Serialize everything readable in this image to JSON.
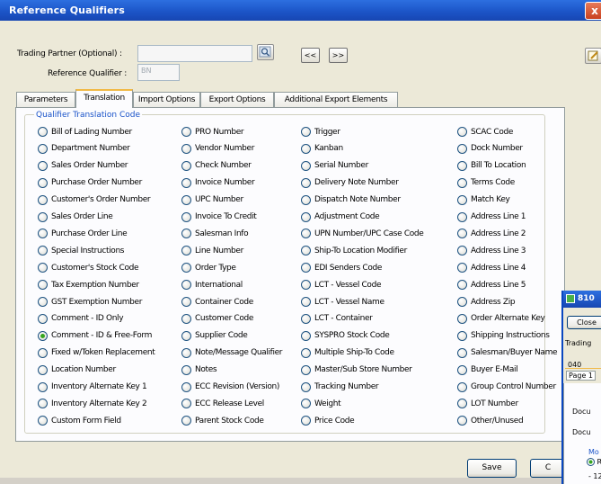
{
  "title": "Reference Qualifiers",
  "close_glyph": "x",
  "trading_partner_label": "Trading Partner (Optional) :",
  "trading_partner_value": "",
  "reference_qualifier_label": "Reference Qualifier :",
  "reference_qualifier_value": "BN",
  "nav_prev": "<<",
  "nav_next": ">>",
  "tabs": [
    "Parameters",
    "Translation",
    "Import Options",
    "Export Options",
    "Additional Export Elements"
  ],
  "active_tab": "Translation",
  "group_title": "Qualifier Translation Code",
  "columns": [
    [
      "Bill of Lading Number",
      "Department Number",
      "Sales Order Number",
      "Purchase Order Number",
      "Customer's Order Number",
      "Sales Order Line",
      "Purchase Order Line",
      "Special Instructions",
      "Customer's Stock Code",
      "Tax Exemption Number",
      "GST Exemption Number",
      "Comment - ID Only",
      "Comment - ID & Free-Form",
      "Fixed w/Token Replacement",
      "Location Number",
      "Inventory Alternate Key 1",
      "Inventory Alternate Key 2",
      "Custom Form Field"
    ],
    [
      "PRO Number",
      "Vendor Number",
      "Check Number",
      "Invoice Number",
      "UPC Number",
      "Invoice To Credit",
      "Salesman Info",
      "Line Number",
      "Order Type",
      "International",
      "Container Code",
      "Customer Code",
      "Supplier Code",
      "Note/Message Qualifier",
      "Notes",
      "ECC Revision (Version)",
      "ECC Release Level",
      "Parent Stock Code"
    ],
    [
      "Trigger",
      "Kanban",
      "Serial Number",
      "Delivery Note Number",
      "Dispatch Note Number",
      "Adjustment Code",
      "UPN Number/UPC Case Code",
      "Ship-To Location Modifier",
      "EDI Senders Code",
      "LCT - Vessel Code",
      "LCT - Vessel Name",
      "LCT - Container",
      "SYSPRO Stock Code",
      "Multiple Ship-To Code",
      "Master/Sub Store Number",
      "Tracking Number",
      "Weight",
      "Price Code"
    ],
    [
      "SCAC Code",
      "Dock Number",
      "Bill To Location",
      "Terms Code",
      "Match Key",
      "Address Line 1",
      "Address Line 2",
      "Address Line 3",
      "Address Line 4",
      "Address Line 5",
      "Address Zip",
      "Order Alternate Key",
      "Shipping Instructions",
      "Salesman/Buyer Name",
      "Buyer E-Mail",
      "Group Control Number",
      "LOT Number",
      "Other/Unused"
    ]
  ],
  "selected_option": "Comment - ID & Free-Form",
  "save_label": "Save",
  "cancel_label": "C",
  "second_window": {
    "title": "810",
    "close_label": "Close",
    "trading_label": "Trading",
    "field_value": "040",
    "tab_label": "Page 1",
    "doc_label_1": "Docu",
    "doc_label_2": "Docu",
    "group_label": "Mo",
    "radio_label": "R",
    "footer": "- 12/"
  },
  "colors": {
    "titlebar": "#1c55c8",
    "group_title": "#1a53c9",
    "active_tab_accent": "#f1b946",
    "selected_radio": "#36a51f"
  }
}
